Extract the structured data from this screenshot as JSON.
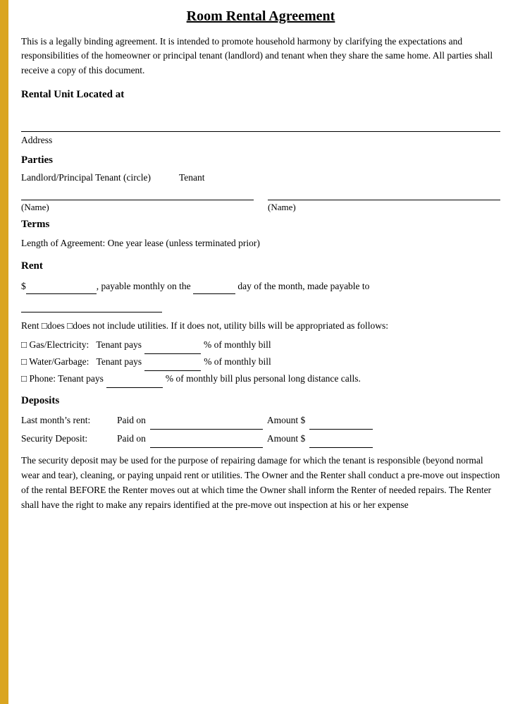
{
  "document": {
    "title": "Room Rental Agreement",
    "intro": "This is a legally binding agreement. It is intended to promote household harmony by clarifying the expectations and responsibilities of the homeowner or principal tenant (landlord) and tenant when they share the same home. All parties shall receive a copy of this document.",
    "sections": {
      "rental_unit": {
        "heading": "Rental Unit Located at",
        "address_label": "Address"
      },
      "parties": {
        "heading": "Parties",
        "landlord_label": "Landlord/Principal Tenant (circle)",
        "tenant_label": "Tenant",
        "name_label": "(Name)",
        "name_label2": "(Name)"
      },
      "terms": {
        "heading": "Terms",
        "text": "Length of Agreement: One year lease (unless terminated prior)"
      },
      "rent": {
        "heading": "Rent",
        "line1_prefix": "$",
        "line1_middle": ", payable monthly on the",
        "line1_suffix": "day of the month, made payable to",
        "utilities_text": "Rent □does □does not include utilities. If it does not, utility bills will be appropriated as follows:",
        "gas_electricity": "□ Gas/Electricity:   Tenant pays",
        "gas_suffix": "% of monthly bill",
        "water_garbage": "□ Water/Garbage:   Tenant pays",
        "water_suffix": "% of monthly bill",
        "phone": "□ Phone: Tenant pays",
        "phone_suffix": "% of monthly bill plus personal long distance calls."
      },
      "deposits": {
        "heading": "Deposits",
        "last_months_label": "Last month’s rent:",
        "paid_on": "Paid on",
        "amount": "Amount $",
        "security_label": "Security Deposit:",
        "paid_on2": "Paid on",
        "amount2": "Amount $",
        "security_text": "The security deposit may be used for the purpose of repairing damage for which the tenant is responsible (beyond normal wear and tear), cleaning, or paying unpaid rent or utilities. The Owner and the Renter shall conduct a pre-move out inspection of the rental BEFORE the Renter moves out at which time the Owner shall inform the Renter of needed repairs. The Renter shall have the right to make any repairs identified at the pre-move out inspection at his or her expense"
      }
    }
  },
  "colors": {
    "yellow_bar": "#DAA520",
    "text": "#000000",
    "background": "#ffffff"
  }
}
